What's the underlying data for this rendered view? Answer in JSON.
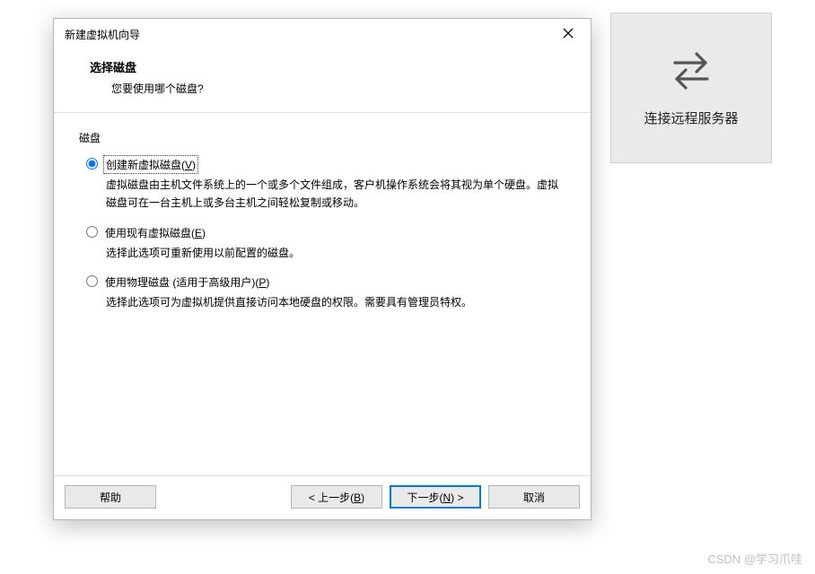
{
  "dialog": {
    "title": "新建虚拟机向导",
    "heading": "选择磁盘",
    "subheading": "您要使用哪个磁盘?",
    "group_label": "磁盘",
    "options": [
      {
        "label_pre": "创建新虚拟磁盘(",
        "mnemonic": "V",
        "label_post": ")",
        "desc": "虚拟磁盘由主机文件系统上的一个或多个文件组成，客户机操作系统会将其视为单个硬盘。虚拟磁盘可在一台主机上或多台主机之间轻松复制或移动。"
      },
      {
        "label_pre": "使用现有虚拟磁盘(",
        "mnemonic": "E",
        "label_post": ")",
        "desc": "选择此选项可重新使用以前配置的磁盘。"
      },
      {
        "label_pre": "使用物理磁盘 (适用于高级用户)(",
        "mnemonic": "P",
        "label_post": ")",
        "desc": "选择此选项可为虚拟机提供直接访问本地硬盘的权限。需要具有管理员特权。"
      }
    ],
    "buttons": {
      "help": "帮助",
      "back_pre": "< 上一步(",
      "back_m": "B",
      "back_post": ")",
      "next_pre": "下一步(",
      "next_m": "N",
      "next_post": ") >",
      "cancel": "取消"
    }
  },
  "side_tile": {
    "label": "连接远程服务器"
  },
  "watermark": "CSDN @学习爪哇"
}
